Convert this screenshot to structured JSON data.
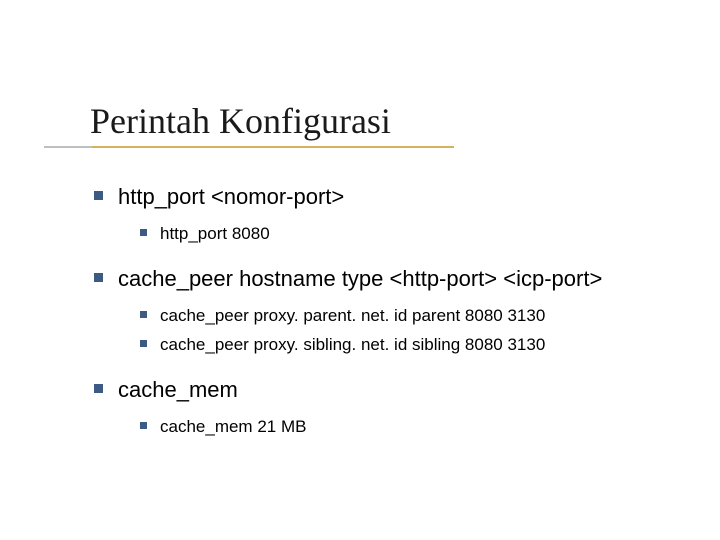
{
  "title": "Perintah Konfigurasi",
  "bullets": [
    {
      "text": "http_port <nomor-port>",
      "sub": [
        {
          "text": "http_port 8080"
        }
      ]
    },
    {
      "text": "cache_peer hostname type <http-port> <icp-port>",
      "sub": [
        {
          "text": "cache_peer proxy. parent. net. id  parent 8080 3130"
        },
        {
          "text": "cache_peer proxy. sibling. net. id sibling 8080 3130"
        }
      ]
    },
    {
      "text": "cache_mem",
      "sub": [
        {
          "text": "cache_mem 21 MB"
        }
      ]
    }
  ]
}
